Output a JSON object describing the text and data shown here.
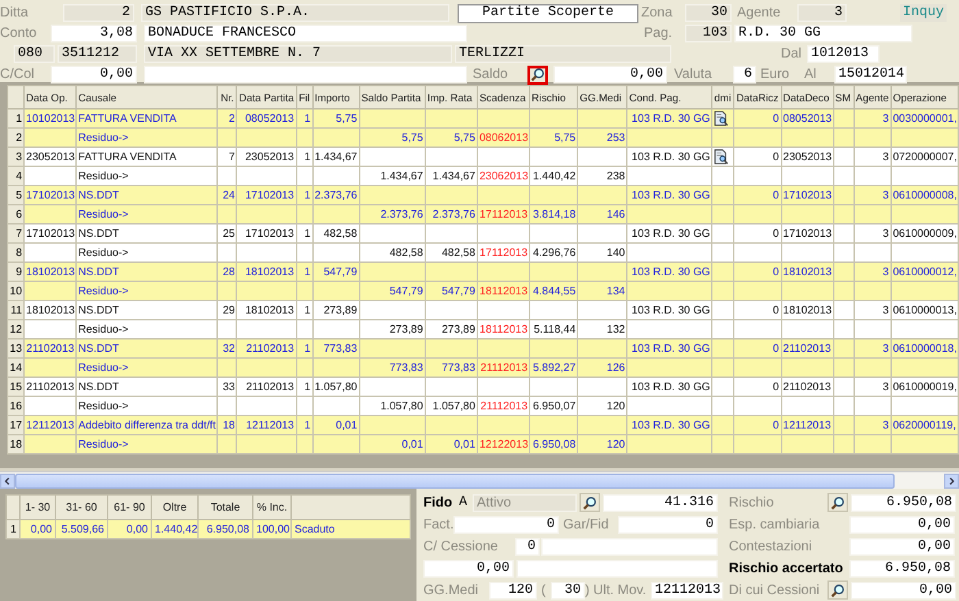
{
  "header": {
    "ditta_label": "Ditta",
    "ditta": "2",
    "company": "GS PASTIFICIO S.P.A.",
    "title_button": "Partite Scoperte",
    "zona_label": "Zona",
    "zona": "30",
    "agente_label": "Agente",
    "agente": "3",
    "inquy": "Inquy",
    "conto_label": "Conto",
    "conto": "3,08",
    "customer": "BONADUCE FRANCESCO",
    "pag_label": "Pag.",
    "pag": "103",
    "pag_desc": "R.D. 30 GG",
    "prefix": "080",
    "phone": "3511212",
    "address": "VIA XX SETTEMBRE N. 7",
    "city": "TERLIZZI",
    "dal_label": "Dal",
    "dal": "1012013",
    "ccol_label": "C/Col",
    "ccol": "0,00",
    "saldo_label": "Saldo",
    "saldo_search_focused": true,
    "saldo": "0,00",
    "valuta_label": "Valuta",
    "valuta": "6",
    "currency": "Euro",
    "al_label": "Al",
    "al": "15012014"
  },
  "table": {
    "columns": [
      "Data Op.",
      "Causale",
      "Nr.",
      "Data Partita",
      "Fil",
      "Importo",
      "Saldo Partita",
      "Imp. Rata",
      "Scadenza",
      "Rischio",
      "GG.Medi",
      "Cond. Pag.",
      "dmi",
      "DataRicz",
      "DataDeco",
      "SM",
      "Agente",
      "Operazione"
    ],
    "rows": [
      {
        "n": "1",
        "highlight": true,
        "doc_icon": true,
        "cells": {
          "data_op": "10102013",
          "causale": "FATTURA VENDITA",
          "nr": "2",
          "data_partita": "08052013",
          "fil": "1",
          "importo": "5,75",
          "cond": "103 R.D. 30 GG",
          "ricz": "0",
          "deco": "08052013",
          "agente": "3",
          "op": "0030000001,"
        }
      },
      {
        "n": "2",
        "highlight": true,
        "doc_icon": false,
        "cells": {
          "causale": "Residuo->",
          "saldo": "5,75",
          "imp_rata": "5,75",
          "scadenza": "08062013",
          "rischio": "5,75",
          "gg": "253"
        }
      },
      {
        "n": "3",
        "highlight": false,
        "doc_icon": true,
        "cells": {
          "data_op": "23052013",
          "causale": "FATTURA VENDITA",
          "nr": "7",
          "data_partita": "23052013",
          "fil": "1",
          "importo": "1.434,67",
          "cond": "103 R.D. 30 GG",
          "ricz": "0",
          "deco": "23052013",
          "agente": "3",
          "op": "0720000007,"
        }
      },
      {
        "n": "4",
        "highlight": false,
        "doc_icon": false,
        "cells": {
          "causale": "Residuo->",
          "saldo": "1.434,67",
          "imp_rata": "1.434,67",
          "scadenza": "23062013",
          "rischio": "1.440,42",
          "gg": "238"
        }
      },
      {
        "n": "5",
        "highlight": true,
        "doc_icon": false,
        "cells": {
          "data_op": "17102013",
          "causale": "NS.DDT",
          "nr": "24",
          "data_partita": "17102013",
          "fil": "1",
          "importo": "2.373,76",
          "cond": "103 R.D. 30 GG",
          "ricz": "0",
          "deco": "17102013",
          "agente": "3",
          "op": "0610000008,"
        }
      },
      {
        "n": "6",
        "highlight": true,
        "doc_icon": false,
        "cells": {
          "causale": "Residuo->",
          "saldo": "2.373,76",
          "imp_rata": "2.373,76",
          "scadenza": "17112013",
          "rischio": "3.814,18",
          "gg": "146"
        }
      },
      {
        "n": "7",
        "highlight": false,
        "doc_icon": false,
        "cells": {
          "data_op": "17102013",
          "causale": "NS.DDT",
          "nr": "25",
          "data_partita": "17102013",
          "fil": "1",
          "importo": "482,58",
          "cond": "103 R.D. 30 GG",
          "ricz": "0",
          "deco": "17102013",
          "agente": "3",
          "op": "0610000009,"
        }
      },
      {
        "n": "8",
        "highlight": false,
        "doc_icon": false,
        "cells": {
          "causale": "Residuo->",
          "saldo": "482,58",
          "imp_rata": "482,58",
          "scadenza": "17112013",
          "rischio": "4.296,76",
          "gg": "140"
        }
      },
      {
        "n": "9",
        "highlight": true,
        "doc_icon": false,
        "cells": {
          "data_op": "18102013",
          "causale": "NS.DDT",
          "nr": "28",
          "data_partita": "18102013",
          "fil": "1",
          "importo": "547,79",
          "cond": "103 R.D. 30 GG",
          "ricz": "0",
          "deco": "18102013",
          "agente": "3",
          "op": "0610000012,"
        }
      },
      {
        "n": "10",
        "highlight": true,
        "doc_icon": false,
        "cells": {
          "causale": "Residuo->",
          "saldo": "547,79",
          "imp_rata": "547,79",
          "scadenza": "18112013",
          "rischio": "4.844,55",
          "gg": "134"
        }
      },
      {
        "n": "11",
        "highlight": false,
        "doc_icon": false,
        "cells": {
          "data_op": "18102013",
          "causale": "NS.DDT",
          "nr": "29",
          "data_partita": "18102013",
          "fil": "1",
          "importo": "273,89",
          "cond": "103 R.D. 30 GG",
          "ricz": "0",
          "deco": "18102013",
          "agente": "3",
          "op": "0610000013,"
        }
      },
      {
        "n": "12",
        "highlight": false,
        "doc_icon": false,
        "cells": {
          "causale": "Residuo->",
          "saldo": "273,89",
          "imp_rata": "273,89",
          "scadenza": "18112013",
          "rischio": "5.118,44",
          "gg": "132"
        }
      },
      {
        "n": "13",
        "highlight": true,
        "doc_icon": false,
        "cells": {
          "data_op": "21102013",
          "causale": "NS.DDT",
          "nr": "32",
          "data_partita": "21102013",
          "fil": "1",
          "importo": "773,83",
          "cond": "103 R.D. 30 GG",
          "ricz": "0",
          "deco": "21102013",
          "agente": "3",
          "op": "0610000018,"
        }
      },
      {
        "n": "14",
        "highlight": true,
        "doc_icon": false,
        "cells": {
          "causale": "Residuo->",
          "saldo": "773,83",
          "imp_rata": "773,83",
          "scadenza": "21112013",
          "rischio": "5.892,27",
          "gg": "126"
        }
      },
      {
        "n": "15",
        "highlight": false,
        "doc_icon": false,
        "cells": {
          "data_op": "21102013",
          "causale": "NS.DDT",
          "nr": "33",
          "data_partita": "21102013",
          "fil": "1",
          "importo": "1.057,80",
          "cond": "103 R.D. 30 GG",
          "ricz": "0",
          "deco": "21102013",
          "agente": "3",
          "op": "0610000019,"
        }
      },
      {
        "n": "16",
        "highlight": false,
        "doc_icon": false,
        "cells": {
          "causale": "Residuo->",
          "saldo": "1.057,80",
          "imp_rata": "1.057,80",
          "scadenza": "21112013",
          "rischio": "6.950,07",
          "gg": "120"
        }
      },
      {
        "n": "17",
        "highlight": true,
        "doc_icon": false,
        "cells": {
          "data_op": "12112013",
          "causale": "Addebito differenza tra ddt/ft",
          "nr": "18",
          "data_partita": "12112013",
          "fil": "1",
          "importo": "0,01",
          "cond": "103 R.D. 30 GG",
          "ricz": "0",
          "deco": "12112013",
          "agente": "3",
          "op": "0620000119,"
        }
      },
      {
        "n": "18",
        "highlight": true,
        "doc_icon": false,
        "cells": {
          "causale": "Residuo->",
          "saldo": "0,01",
          "imp_rata": "0,01",
          "scadenza": "12122013",
          "rischio": "6.950,08",
          "gg": "120"
        }
      }
    ]
  },
  "aging": {
    "columns": [
      "1- 30",
      "31- 60",
      "61- 90",
      "Oltre",
      "Totale",
      "% Inc."
    ],
    "rows": [
      {
        "n": "1",
        "values": [
          "0,00",
          "5.509,66",
          "0,00",
          "1.440,42",
          "6.950,08",
          "100,00"
        ],
        "status": "Scaduto"
      }
    ]
  },
  "risk": {
    "fido_label": "Fido",
    "fido_code": "A",
    "fido_status": "Attivo",
    "fido_value": "41.316",
    "rischio_label": "Rischio",
    "rischio": "6.950,08",
    "fact_label": "Fact.",
    "fact": "0",
    "garfid_label": "Gar/Fid",
    "garfid": "0",
    "esp_label": "Esp. cambiaria",
    "esp": "0,00",
    "cessione_label": "C/ Cessione",
    "cessione": "0",
    "contest_label": "Contestazioni",
    "contest": "0,00",
    "amount": "0,00",
    "accertato_label": "Rischio accertato",
    "accertato": "6.950,08",
    "ggmedi_label": "GG.Medi",
    "ggmedi": "120",
    "paren_open": "(",
    "days": "30",
    "paren_close": ")",
    "ultmov_label": "Ult. Mov.",
    "ultmov": "12112013",
    "cessioni_label": "Di cui Cessioni",
    "cessioni": "0,00"
  }
}
